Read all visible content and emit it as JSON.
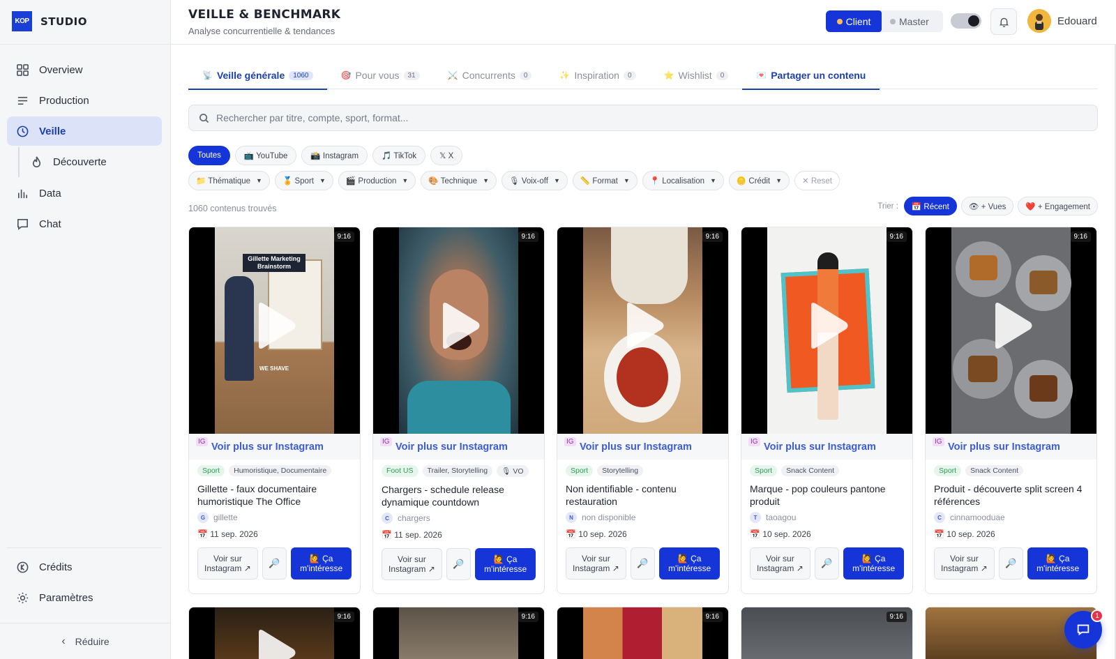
{
  "brand": {
    "logo": "KOP",
    "name": "STUDIO"
  },
  "nav": {
    "items": [
      {
        "label": "Overview",
        "icon": "grid-icon"
      },
      {
        "label": "Production",
        "icon": "list-icon"
      },
      {
        "label": "Veille",
        "icon": "clock-icon",
        "active": true
      }
    ],
    "sub_item": "Découverte",
    "items_after": [
      {
        "label": "Data",
        "icon": "bar-chart-icon"
      },
      {
        "label": "Chat",
        "icon": "chat-icon"
      }
    ],
    "bottom": [
      {
        "label": "Crédits",
        "icon": "credit-icon"
      },
      {
        "label": "Paramètres",
        "icon": "settings-icon"
      }
    ],
    "collapse": "Réduire"
  },
  "header": {
    "title": "VEILLE & BENCHMARK",
    "subtitle": "Analyse concurrentielle & tendances",
    "mode_client": "Client",
    "mode_master": "Master",
    "user_name": "Edouard"
  },
  "tabs": [
    {
      "label": "Veille générale",
      "count": "1060",
      "emoji": "📡"
    },
    {
      "label": "Pour vous",
      "count": "31",
      "emoji": "🎯"
    },
    {
      "label": "Concurrents",
      "count": "0",
      "emoji": "⚔️"
    },
    {
      "label": "Inspiration",
      "count": "0",
      "emoji": "✨"
    },
    {
      "label": "Wishlist",
      "count": "0",
      "emoji": "⭐"
    },
    {
      "label": "Partager un contenu",
      "emoji": "💌"
    }
  ],
  "search": {
    "placeholder": "Rechercher par titre, compte, sport, format..."
  },
  "platform_chips": [
    "Toutes",
    "📺 YouTube",
    "📸 Instagram",
    "🎵 TikTok",
    "𝕏 X"
  ],
  "filters": [
    "📁 Thématique",
    "🏅 Sport",
    "🎬 Production",
    "🎨 Technique",
    "🎙 Voix-off",
    "📏 Format",
    "📍 Localisation",
    "🪙 Crédit"
  ],
  "reset_label": "✕ Reset",
  "results_count": "1060 contenus trouvés",
  "sort": {
    "label": "Trier :",
    "options": [
      "📅 Récent",
      "👁 + Vues",
      "❤️ + Engagement"
    ]
  },
  "card_labels": {
    "ratio": "9:16",
    "ig_badge": "IG",
    "ig_link": "Voir plus sur Instagram",
    "see_btn": "Voir sur Instagram ↗",
    "zoom_btn": "🔎",
    "like_btn": "🙋 Ça m'intéresse"
  },
  "cards": [
    {
      "tags": [
        "Sport",
        "Humoristique, Documentaire"
      ],
      "title": "Gillette - faux documentaire humoristique The Office",
      "account": "gillette",
      "initial": "G",
      "date": "📅 11 sep. 2026",
      "thumb_text_1": "Gillette Marketing Brainstorm",
      "thumb_text_2": "WE SHAVE"
    },
    {
      "tags": [
        "Foot US",
        "Trailer, Storytelling",
        "🎙 VO"
      ],
      "title": "Chargers - schedule release dynamique countdown",
      "account": "chargers",
      "initial": "C",
      "date": "📅 11 sep. 2026"
    },
    {
      "tags": [
        "Sport",
        "Storytelling"
      ],
      "title": "Non identifiable - contenu restauration",
      "account": "non disponible",
      "initial": "N",
      "date": "📅 10 sep. 2026"
    },
    {
      "tags": [
        "Sport",
        "Snack Content"
      ],
      "title": "Marque - pop couleurs pantone produit",
      "account": "taoagou",
      "initial": "T",
      "date": "📅 10 sep. 2026"
    },
    {
      "tags": [
        "Sport",
        "Snack Content"
      ],
      "title": "Produit - découverte split screen 4 références",
      "account": "cinnamooduae",
      "initial": "C",
      "date": "📅 10 sep. 2026"
    }
  ],
  "notifications": {
    "chat_badge": "1"
  }
}
